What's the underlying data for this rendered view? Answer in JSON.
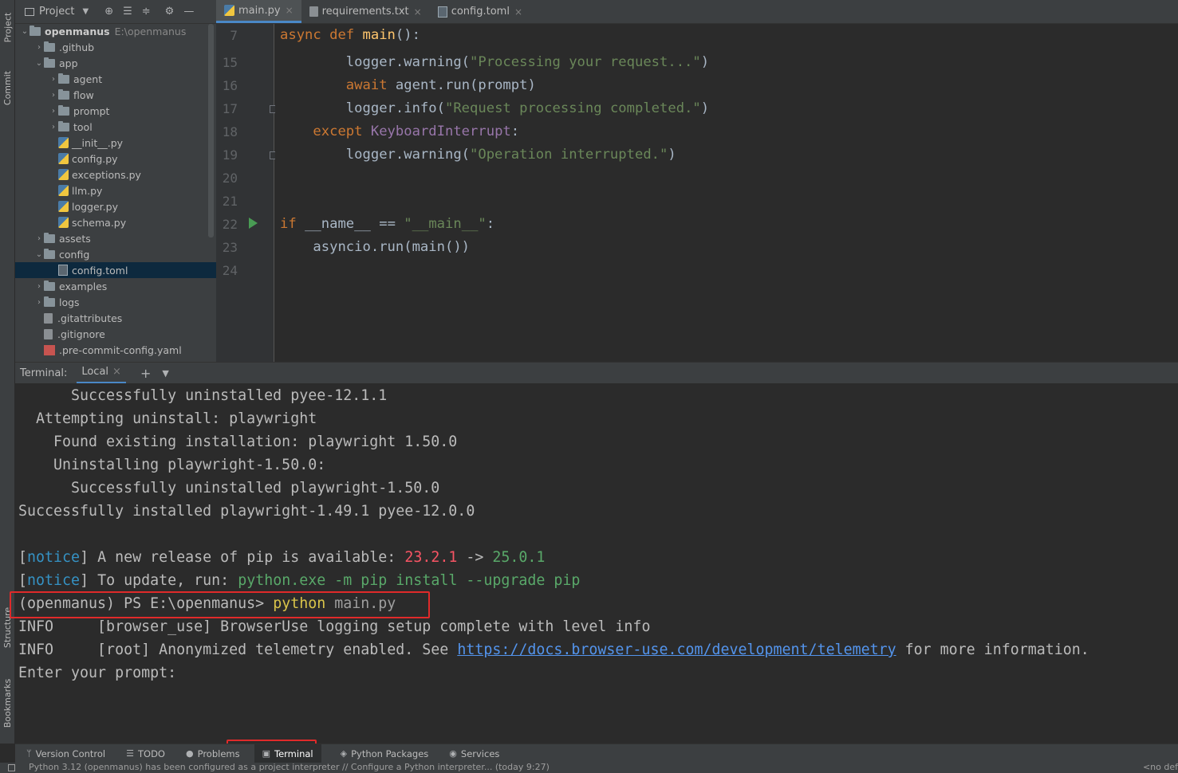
{
  "left_strip": {
    "project": "Project",
    "commit": "Commit",
    "structure": "Structure",
    "bookmarks": "Bookmarks"
  },
  "project_panel": {
    "title": "Project",
    "root": {
      "name": "openmanus",
      "path": "E:\\openmanus"
    },
    "items": [
      {
        "label": ".github",
        "type": "folder",
        "expanded": false
      },
      {
        "label": "app",
        "type": "folder",
        "expanded": true
      },
      {
        "label": "agent",
        "type": "folder",
        "expanded": false
      },
      {
        "label": "flow",
        "type": "folder",
        "expanded": false
      },
      {
        "label": "prompt",
        "type": "folder",
        "expanded": false
      },
      {
        "label": "tool",
        "type": "folder",
        "expanded": false
      },
      {
        "label": "__init__.py",
        "type": "py"
      },
      {
        "label": "config.py",
        "type": "py"
      },
      {
        "label": "exceptions.py",
        "type": "py"
      },
      {
        "label": "llm.py",
        "type": "py"
      },
      {
        "label": "logger.py",
        "type": "py"
      },
      {
        "label": "schema.py",
        "type": "py"
      },
      {
        "label": "assets",
        "type": "folder",
        "expanded": false
      },
      {
        "label": "config",
        "type": "folder",
        "expanded": true
      },
      {
        "label": "config.toml",
        "type": "toml",
        "selected": true
      },
      {
        "label": "examples",
        "type": "folder",
        "expanded": false
      },
      {
        "label": "logs",
        "type": "folder",
        "expanded": false
      },
      {
        "label": ".gitattributes",
        "type": "git"
      },
      {
        "label": ".gitignore",
        "type": "git"
      },
      {
        "label": ".pre-commit-config.yaml",
        "type": "yaml"
      }
    ]
  },
  "editor": {
    "tabs": [
      {
        "label": "main.py",
        "active": true
      },
      {
        "label": "requirements.txt",
        "active": false
      },
      {
        "label": "config.toml",
        "active": false
      }
    ],
    "line_numbers": [
      "7",
      "15",
      "16",
      "17",
      "18",
      "19",
      "20",
      "21",
      "22",
      "23",
      "24"
    ],
    "code": {
      "l7_async": "async",
      "l7_def": "def",
      "l7_main": "main",
      "l7_rest": "():",
      "l15_a": "logger.warning(",
      "l15_str": "\"Processing your request...\"",
      "l15_b": ")",
      "l16_await": "await",
      "l16_rest": "agent.run(prompt)",
      "l17_a": "logger.info(",
      "l17_str": "\"Request processing completed.\"",
      "l17_b": ")",
      "l18_except": "except",
      "l18_cls": "KeyboardInterrupt",
      "l18_b": ":",
      "l19_a": "logger.warning(",
      "l19_str": "\"Operation interrupted.\"",
      "l19_b": ")",
      "l22_if": "if",
      "l22_name": "__name__",
      "l22_eq": "==",
      "l22_str": "\"__main__\"",
      "l22_b": ":",
      "l23": "asyncio.run(main())"
    }
  },
  "terminal": {
    "label": "Terminal:",
    "tab": "Local",
    "lines": {
      "t1": "      Successfully uninstalled pyee-12.1.1",
      "t2": "  Attempting uninstall: playwright",
      "t3": "    Found existing installation: playwright 1.50.0",
      "t4": "    Uninstalling playwright-1.50.0:",
      "t5": "      Successfully uninstalled playwright-1.50.0",
      "t6": "Successfully installed playwright-1.49.1 pyee-12.0.0",
      "n1_bracket_open": "[",
      "n1_notice": "notice",
      "n1_bracket_close": "]",
      "n1_text": " A new release of pip is available: ",
      "n1_old": "23.2.1",
      "n1_arrow": " -> ",
      "n1_new": "25.0.1",
      "n2_bracket_open": "[",
      "n2_notice": "notice",
      "n2_bracket_close": "]",
      "n2_text": " To update, run: ",
      "n2_cmd": "python.exe -m pip install --upgrade pip",
      "p_prompt": "(openmanus) PS E:\\openmanus> ",
      "p_cmd": "python",
      "p_arg": " main.py",
      "i1": "INFO     [browser_use] BrowserUse logging setup complete with level info",
      "i2_a": "INFO     [root] Anonymized telemetry enabled. See ",
      "i2_link": "https://docs.browser-use.com/development/telemetry",
      "i2_b": " for more information.",
      "enter": "Enter your prompt:"
    }
  },
  "toolwindows": [
    {
      "label": "Version Control",
      "icon": "branch-icon"
    },
    {
      "label": "TODO",
      "icon": "list-icon"
    },
    {
      "label": "Problems",
      "icon": "info-icon"
    },
    {
      "label": "Terminal",
      "icon": "terminal-icon",
      "active": true
    },
    {
      "label": "Python Packages",
      "icon": "packages-icon"
    },
    {
      "label": "Services",
      "icon": "services-icon"
    }
  ],
  "status": {
    "message": "Python 3.12 (openmanus) has been configured as a project interpreter // Configure a Python interpreter... (today 9:27)",
    "right": "<no def"
  },
  "colors": {
    "highlight_box": "#e02a2a",
    "accent": "#4a88c7"
  }
}
